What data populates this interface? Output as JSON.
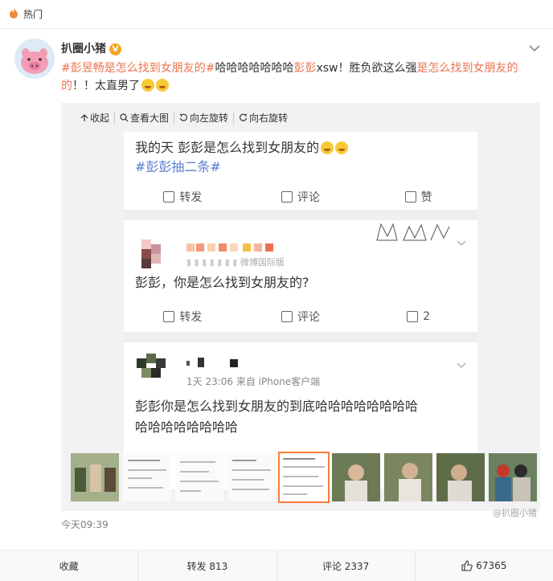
{
  "header": {
    "label": "热门"
  },
  "post": {
    "username": "扒圈小猪",
    "verified_badge": "V",
    "text": {
      "tag1": "#彭昱畅是怎么找到女朋友的#",
      "part1": "哈哈哈哈哈哈哈",
      "name": "彭彭",
      "part2": "xsw！胜负欲这么强",
      "hl2": "是怎么找到女朋友的",
      "part3": "！！太直男了"
    },
    "timestamp": "今天09:39"
  },
  "toolbar": {
    "collapse": "收起",
    "view_large": "查看大图",
    "rotate_left": "向左旋转",
    "rotate_right": "向右旋转"
  },
  "screenshot": {
    "card1": {
      "text": "我的天 彭彭是怎么找到女朋友的",
      "tag": "#彭彭抽二条#",
      "repost": "转发",
      "comment": "评论",
      "like": "赞"
    },
    "card2": {
      "meta_visible": "微博国际版",
      "text": "彭彭，你是怎么找到女朋友的?",
      "repost": "转发",
      "comment": "评论",
      "likes": "2"
    },
    "card3": {
      "meta_visible": "1天 23:06  来自 iPhone客户端",
      "text_line1": "彭彭你是怎么找到女朋友的到底哈哈哈哈哈哈哈哈",
      "text_line2": "哈哈哈哈哈哈哈哈",
      "watermark": "@扒圈小猪"
    }
  },
  "footer": {
    "favorite": "收藏",
    "repost": "转发 813",
    "comment": "评论 2337",
    "like": "67365"
  },
  "colors": {
    "accent": "#eb7350",
    "tag_blue": "#5b7dcf",
    "thumb_active": "#fa7d3c"
  }
}
